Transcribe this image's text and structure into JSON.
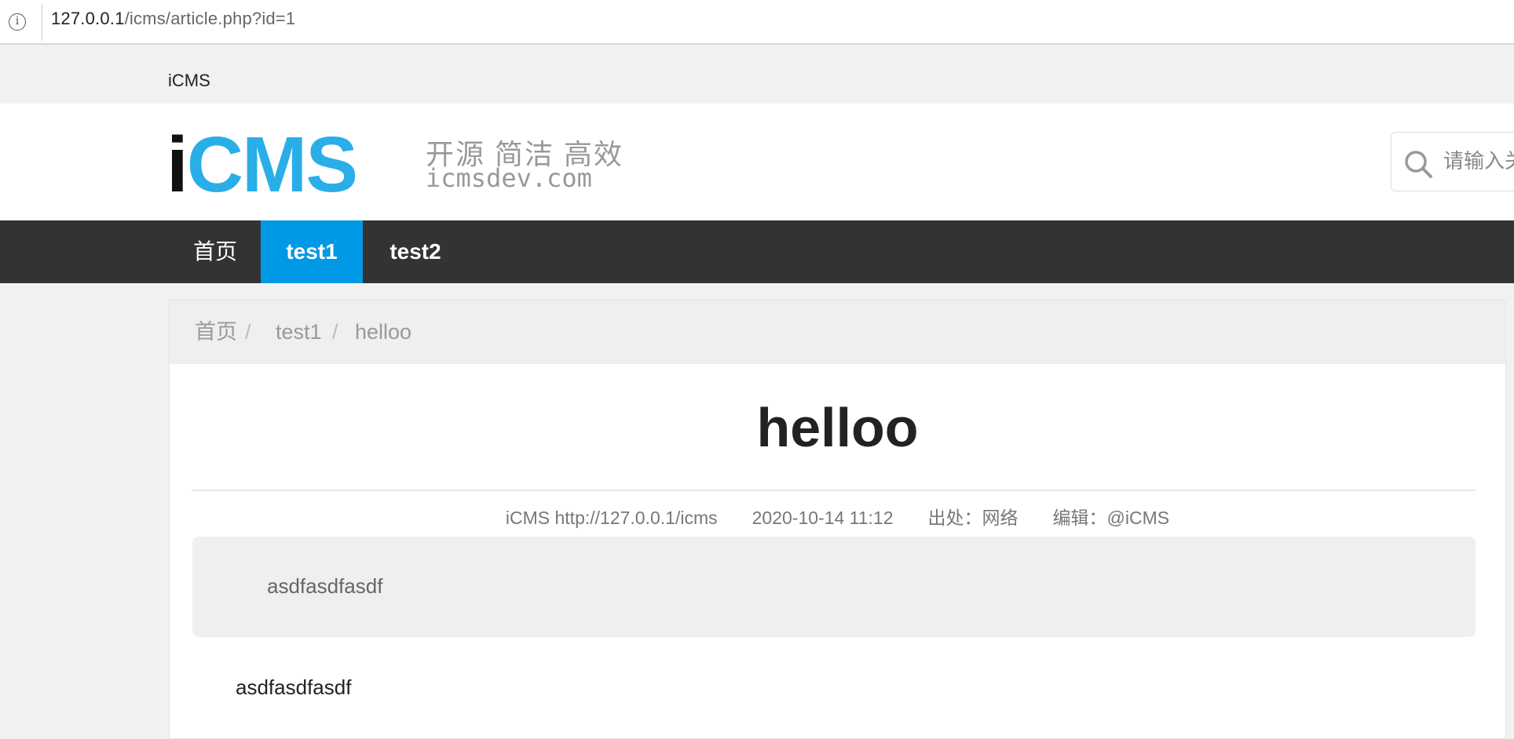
{
  "browser": {
    "url_host": "127.0.0.1",
    "url_path": "/icms/article.php?id=1"
  },
  "topbar": {
    "site_name": "iCMS"
  },
  "header": {
    "logo": {
      "mark_i": "i",
      "mark_cms": "CMS",
      "slogan": "开源 简洁 高效",
      "domain": "icmsdev.com"
    },
    "search": {
      "placeholder": "请输入关"
    }
  },
  "nav": {
    "items": [
      {
        "label": "首页"
      },
      {
        "label": "test1"
      },
      {
        "label": "test2"
      }
    ]
  },
  "breadcrumb": {
    "home": "首页",
    "separator": "/",
    "category": "test1",
    "current": "helloo"
  },
  "article": {
    "title": "helloo",
    "meta": {
      "source_site": "iCMS http://127.0.0.1/icms",
      "datetime": "2020-10-14 11:12",
      "origin": "出处：网络",
      "editor": "编辑：@iCMS"
    },
    "summary": "asdfasdfasdf",
    "body": "asdfasdfasdf"
  },
  "colors": {
    "accent": "#0099e5",
    "nav_bg": "#333333",
    "logo_blue": "#2aaee8"
  }
}
